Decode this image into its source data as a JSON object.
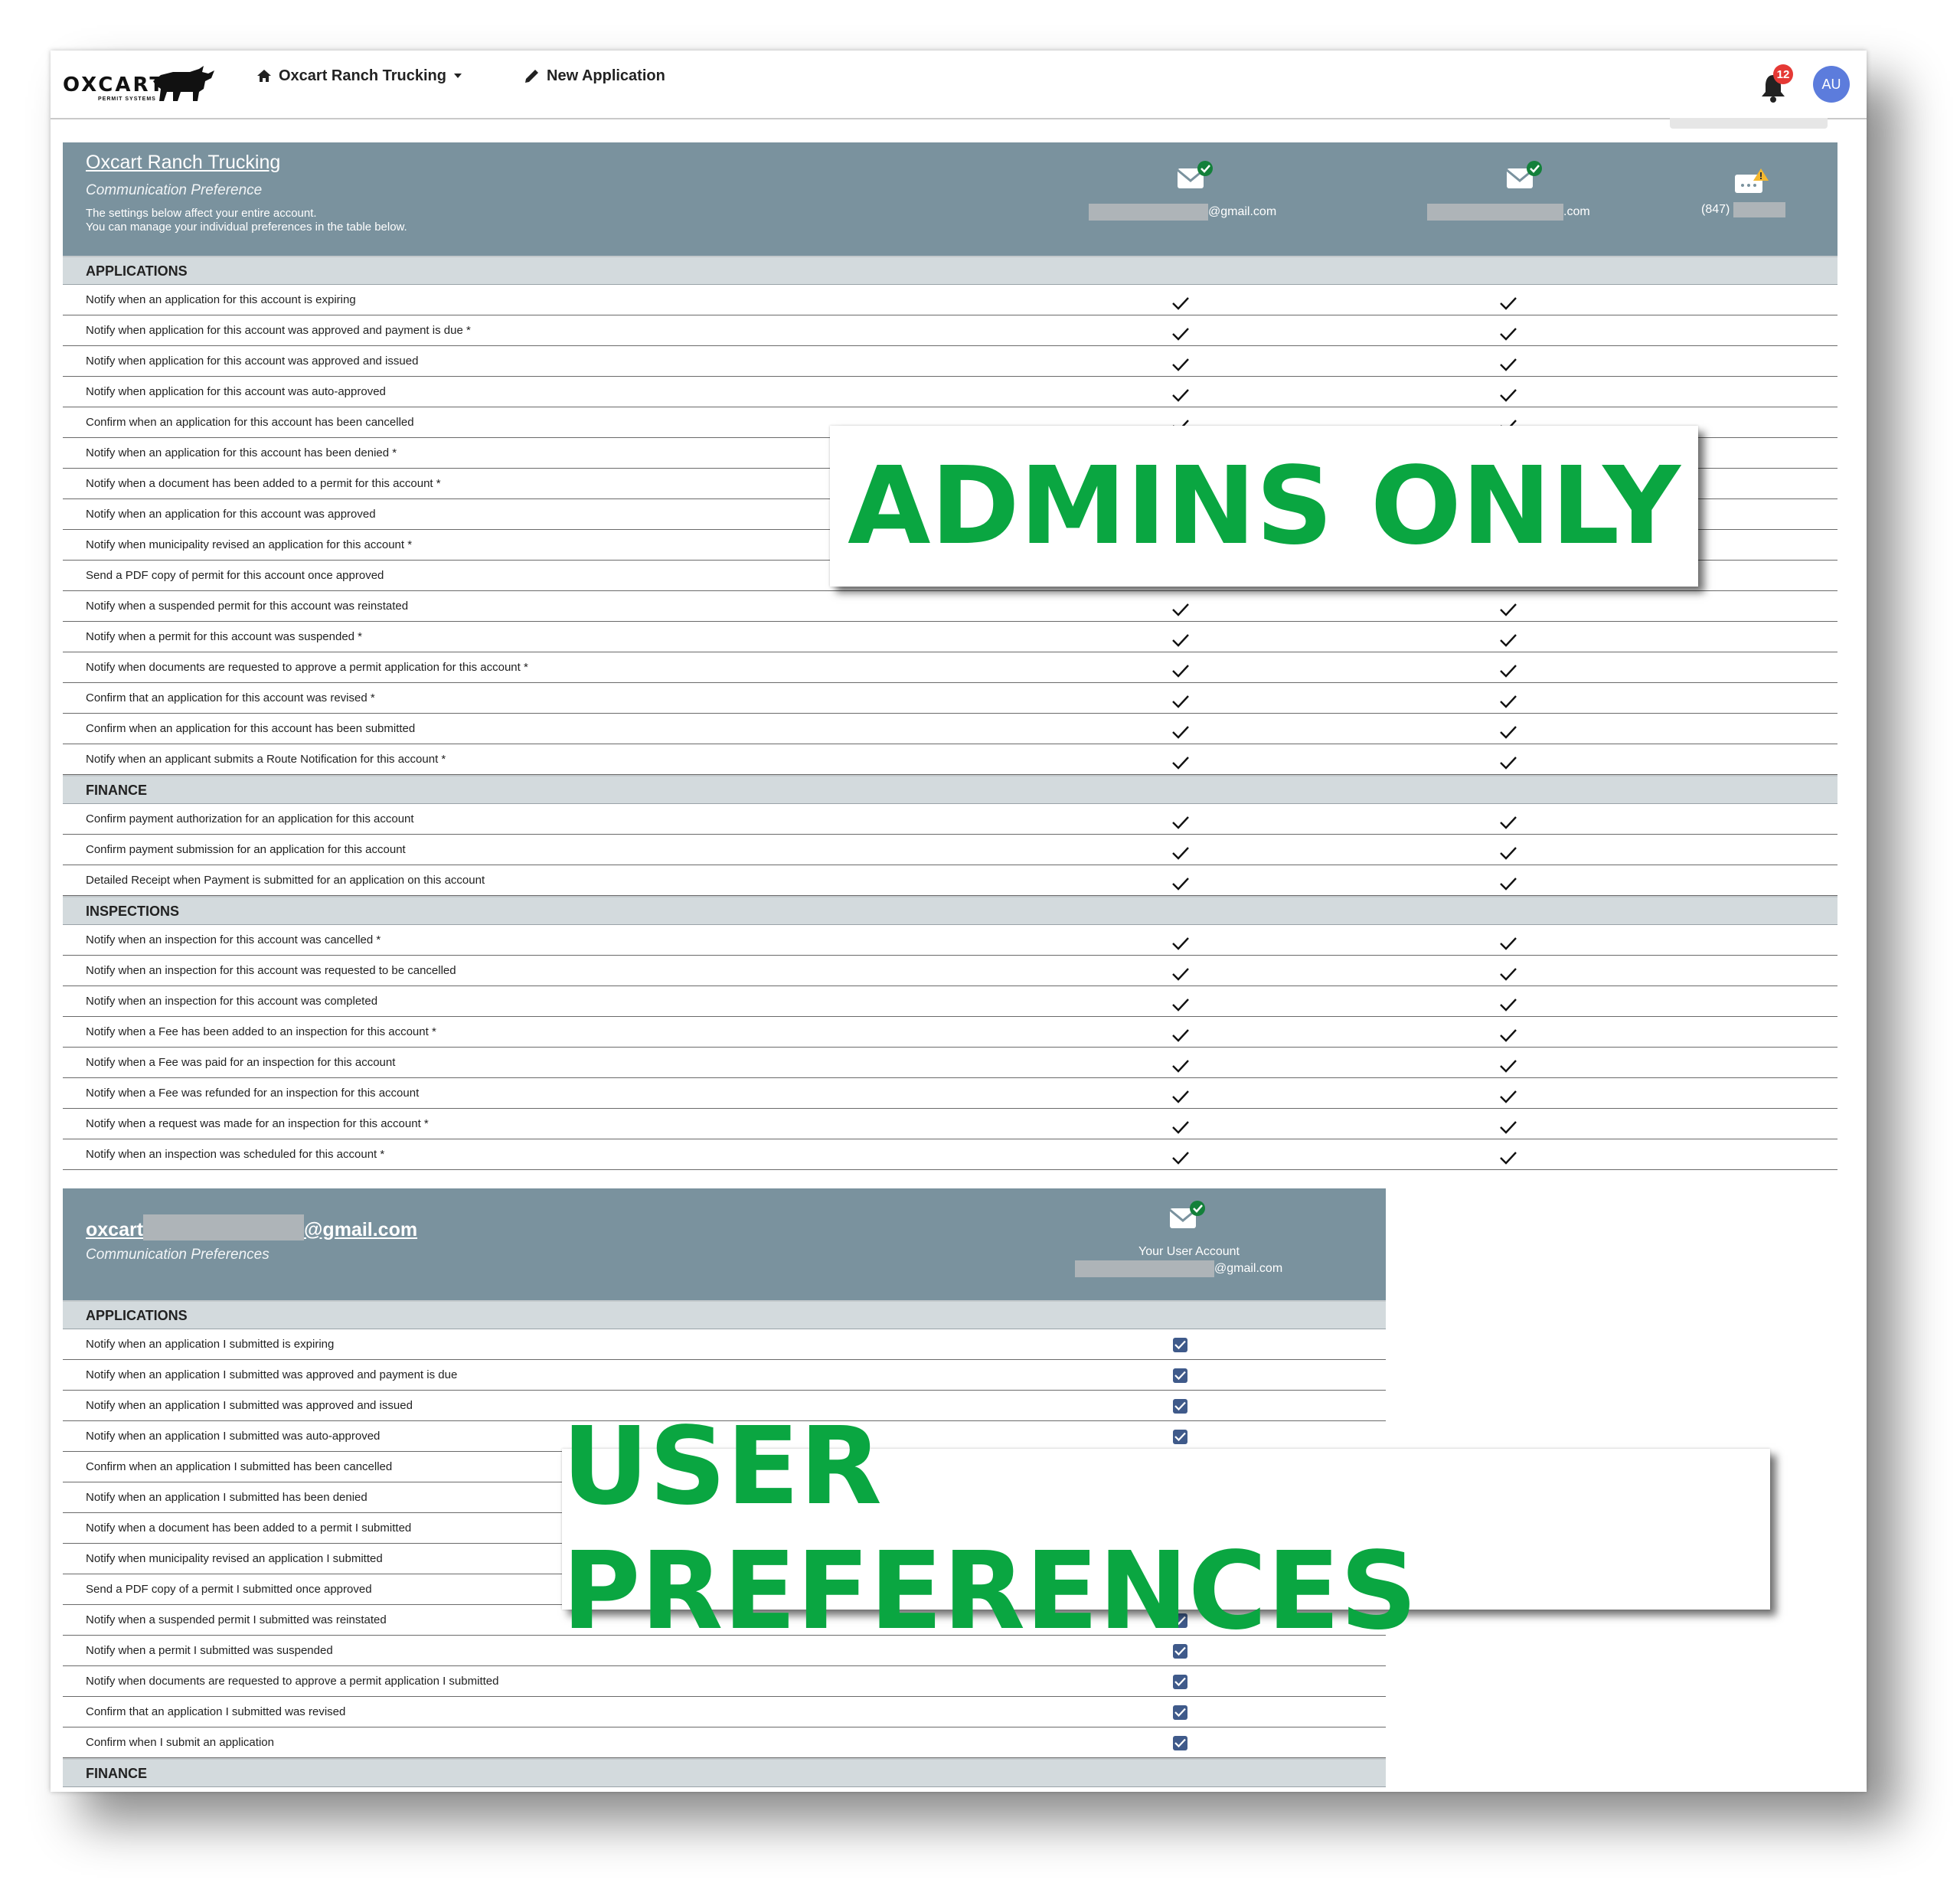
{
  "nav": {
    "logo_text": "OXCART",
    "logo_sub": "PERMIT SYSTEMS",
    "account_menu": "Oxcart Ranch Trucking",
    "new_application": "New Application",
    "notification_count": "12",
    "avatar_initials": "AU"
  },
  "account_table": {
    "account_name": "Oxcart Ranch Trucking",
    "subtitle": "Communication Preference",
    "note_line1": "The settings below affect your entire account.",
    "note_line2": "You can manage your individual preferences in the table below.",
    "contacts": [
      {
        "suffix": "@gmail.com",
        "icon": "email-verified-icon"
      },
      {
        "suffix": ".com",
        "icon": "email-verified-icon"
      },
      {
        "suffix": "(847)",
        "icon": "sms-warning-icon"
      }
    ],
    "sections": [
      {
        "title": "APPLICATIONS",
        "rows": [
          "Notify when an application for this account is expiring",
          "Notify when application for this account was approved and payment is due *",
          "Notify when application for this account was approved and issued",
          "Notify when application for this account was auto-approved",
          "Confirm when an application for this account has been cancelled",
          "Notify when an application for this account has been denied *",
          "Notify when a document has been added to a permit for this account *",
          "Notify when an application for this account was approved",
          "Notify when municipality revised an application for this account *",
          "Send a PDF copy of permit for this account once approved",
          "Notify when a suspended permit for this account was reinstated",
          "Notify when a permit for this account was suspended *",
          "Notify when documents are requested to approve a permit application for this account *",
          "Confirm that an application for this account was revised *",
          "Confirm when an application for this account has been submitted",
          "Notify when an applicant submits a Route Notification for this account *"
        ]
      },
      {
        "title": "FINANCE",
        "rows": [
          "Confirm payment authorization for an application for this account",
          "Confirm payment submission for an application for this account",
          "Detailed Receipt when Payment is submitted for an application on this account"
        ]
      },
      {
        "title": "INSPECTIONS",
        "rows": [
          "Notify when an inspection for this account was cancelled *",
          "Notify when an inspection for this account was requested to be cancelled",
          "Notify when an inspection for this account was completed",
          "Notify when a Fee has been added to an inspection for this account *",
          "Notify when a Fee was paid for an inspection for this account",
          "Notify when a Fee was refunded for an inspection for this account",
          "Notify when a request was made for an inspection for this account *",
          "Notify when an inspection was scheduled for this account *"
        ]
      }
    ]
  },
  "user_table": {
    "user_prefix": "oxcart",
    "user_suffix": "@gmail.com",
    "subtitle": "Communication Preferences",
    "contact_label": "Your User Account",
    "contact_suffix": "@gmail.com",
    "sections": [
      {
        "title": "APPLICATIONS",
        "rows": [
          "Notify when an application I submitted is expiring",
          "Notify when an application I submitted was approved and payment is due",
          "Notify when an application I submitted was approved and issued",
          "Notify when an application I submitted was auto-approved",
          "Confirm when an application I submitted has been cancelled",
          "Notify when an application I submitted has been denied",
          "Notify when a document has been added to a permit I submitted",
          "Notify when municipality revised an application I submitted",
          "Send a PDF copy of a permit I submitted once approved",
          "Notify when a suspended permit I submitted was reinstated",
          "Notify when a permit I submitted was suspended",
          "Notify when documents are requested to approve a permit application I submitted",
          "Confirm that an application I submitted was revised",
          "Confirm when I submit an application"
        ]
      },
      {
        "title": "FINANCE",
        "rows": []
      }
    ]
  },
  "overlays": {
    "admins_only": "ADMINS ONLY",
    "user_preferences": "USER PREFERENCES"
  },
  "colors": {
    "header_bg": "#7a929e",
    "section_bg": "#d3dadd",
    "overlay_text": "#0aa641",
    "checkbox": "#3f5a8a",
    "badge": "#e53935",
    "avatar": "#5c7cdc"
  }
}
